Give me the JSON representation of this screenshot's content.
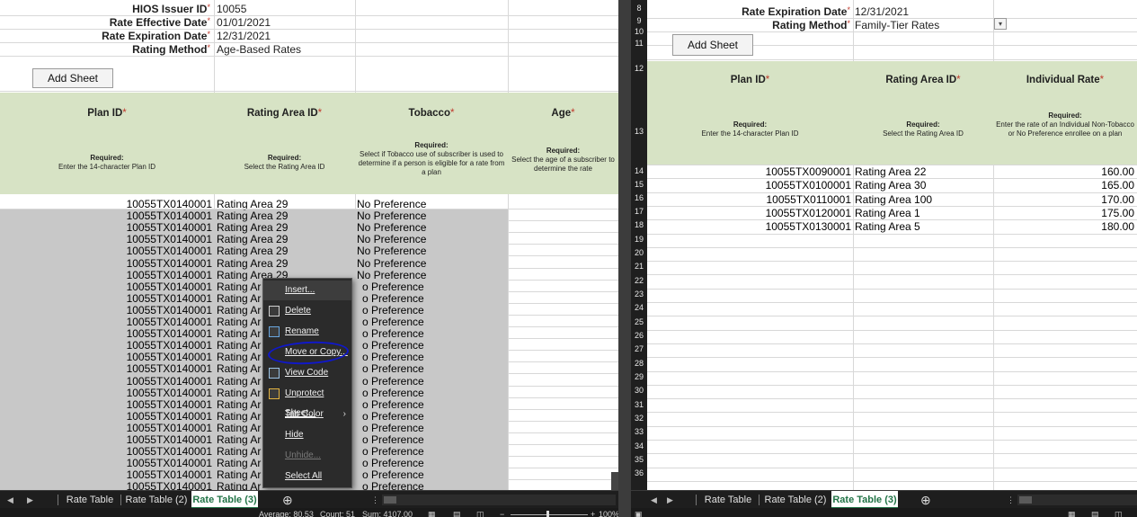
{
  "left": {
    "meta": [
      {
        "label": "HIOS Issuer ID",
        "value": "10055"
      },
      {
        "label": "Rate Effective Date",
        "value": "01/01/2021"
      },
      {
        "label": "Rate Expiration Date",
        "value": "12/31/2021"
      },
      {
        "label": "Rating Method",
        "value": "Age-Based Rates"
      }
    ],
    "add_sheet_label": "Add Sheet",
    "headers": [
      {
        "title": "Plan ID",
        "req": "Required:",
        "desc": "Enter the 14-character Plan ID"
      },
      {
        "title": "Rating Area ID",
        "req": "Required:",
        "desc": "Select the Rating Area ID"
      },
      {
        "title": "Tobacco",
        "req": "Required:",
        "desc": "Select if Tobacco use of subscriber is used to determine if a person is eligible for a rate from a plan"
      },
      {
        "title": "Age",
        "req": "Required:",
        "desc": "Select the age of a subscriber to determine the rate"
      }
    ],
    "rows_full": [
      [
        "10055TX0140001",
        "Rating Area 29",
        "No Preference"
      ],
      [
        "10055TX0140001",
        "Rating Area 29",
        "No Preference"
      ],
      [
        "10055TX0140001",
        "Rating Area 29",
        "No Preference"
      ],
      [
        "10055TX0140001",
        "Rating Area 29",
        "No Preference"
      ],
      [
        "10055TX0140001",
        "Rating Area 29",
        "No Preference"
      ],
      [
        "10055TX0140001",
        "Rating Area 29",
        "No Preference"
      ],
      [
        "10055TX0140001",
        "Rating Area 29",
        "No Preference"
      ]
    ],
    "rows_partial": [
      [
        "10055TX0140001",
        "Rating Ar",
        "o Preference"
      ],
      [
        "10055TX0140001",
        "Rating Ar",
        "o Preference"
      ],
      [
        "10055TX0140001",
        "Rating Ar",
        "o Preference"
      ],
      [
        "10055TX0140001",
        "Rating Ar",
        "o Preference"
      ],
      [
        "10055TX0140001",
        "Rating Ar",
        "o Preference"
      ],
      [
        "10055TX0140001",
        "Rating Ar",
        "o Preference"
      ],
      [
        "10055TX0140001",
        "Rating Ar",
        "o Preference"
      ],
      [
        "10055TX0140001",
        "Rating Ar",
        "o Preference"
      ],
      [
        "10055TX0140001",
        "Rating Ar",
        "o Preference"
      ],
      [
        "10055TX0140001",
        "Rating Ar",
        "o Preference"
      ],
      [
        "10055TX0140001",
        "Rating Ar",
        "o Preference"
      ],
      [
        "10055TX0140001",
        "Rating Ar",
        "o Preference"
      ],
      [
        "10055TX0140001",
        "Rating Ar",
        "o Preference"
      ],
      [
        "10055TX0140001",
        "Rating Ar",
        "o Preference"
      ],
      [
        "10055TX0140001",
        "Rating Ar",
        "o Preference"
      ],
      [
        "10055TX0140001",
        "Rating Ar",
        "o Preference"
      ],
      [
        "10055TX0140001",
        "Rating Ar",
        "o Preference"
      ],
      [
        "10055TX0140001",
        "Rating Ar",
        "o Preference"
      ],
      [
        "10055TX0140001",
        "Rating Ar",
        "o Preference"
      ]
    ],
    "tabs": [
      "Rate Table",
      "Rate Table (2)",
      "Rate Table (3)"
    ],
    "active_tab": "Rate Table (3)",
    "status": {
      "average": "Average: 80.53",
      "count": "Count: 51",
      "sum": "Sum: 4107.00",
      "zoom": "100%"
    }
  },
  "context_menu": {
    "items": [
      {
        "label": "Insert...",
        "icon": "none"
      },
      {
        "label": "Delete",
        "icon": "delete-sheet-icon"
      },
      {
        "label": "Rename",
        "icon": "rename-sheet-icon"
      },
      {
        "label": "Move or Copy...",
        "icon": "none"
      },
      {
        "label": "View Code",
        "icon": "view-code-icon"
      },
      {
        "label": "Unprotect Sheet...",
        "icon": "unprotect-sheet-icon"
      },
      {
        "label": "Tab Color",
        "icon": "none",
        "submenu": true
      },
      {
        "label": "Hide",
        "icon": "none"
      },
      {
        "label": "Unhide...",
        "icon": "none",
        "disabled": true
      },
      {
        "label": "Select All Sheets",
        "icon": "none"
      }
    ]
  },
  "right": {
    "meta": [
      {
        "label": "Rate Expiration Date",
        "value": "12/31/2021"
      },
      {
        "label": "Rating Method",
        "value": "Family-Tier Rates"
      }
    ],
    "add_sheet_label": "Add Sheet",
    "headers": [
      {
        "title": "Plan ID",
        "req": "Required:",
        "desc": "Enter the 14-character Plan ID"
      },
      {
        "title": "Rating Area ID",
        "req": "Required:",
        "desc": "Select the Rating Area ID"
      },
      {
        "title": "Individual Rate",
        "req": "Required:",
        "desc": "Enter the rate of an Individual Non-Tobacco or No Preference enrollee on a plan"
      }
    ],
    "row_numbers": [
      "8",
      "9",
      "10",
      "11",
      "12",
      "13",
      "14",
      "15",
      "16",
      "17",
      "18",
      "19",
      "20",
      "21",
      "22",
      "23",
      "24",
      "25",
      "26",
      "27",
      "28",
      "29",
      "30",
      "31",
      "32",
      "33",
      "34",
      "35",
      "36"
    ],
    "rows": [
      [
        "10055TX0090001",
        "Rating Area 22",
        "160.00"
      ],
      [
        "10055TX0100001",
        "Rating Area 30",
        "165.00"
      ],
      [
        "10055TX0110001",
        "Rating Area 100",
        "170.00"
      ],
      [
        "10055TX0120001",
        "Rating Area 1",
        "175.00"
      ],
      [
        "10055TX0130001",
        "Rating Area 5",
        "180.00"
      ]
    ],
    "tabs": [
      "Rate Table",
      "Rate Table (2)",
      "Rate Table (3)"
    ],
    "active_tab": "Rate Table (3)"
  },
  "colors": {
    "header_band": "#d7e3c5",
    "grey_selection": "#c8c8c8",
    "active_tab_text": "#217346",
    "annotation_circle": "#1018c9",
    "required_star": "#c0392b"
  }
}
